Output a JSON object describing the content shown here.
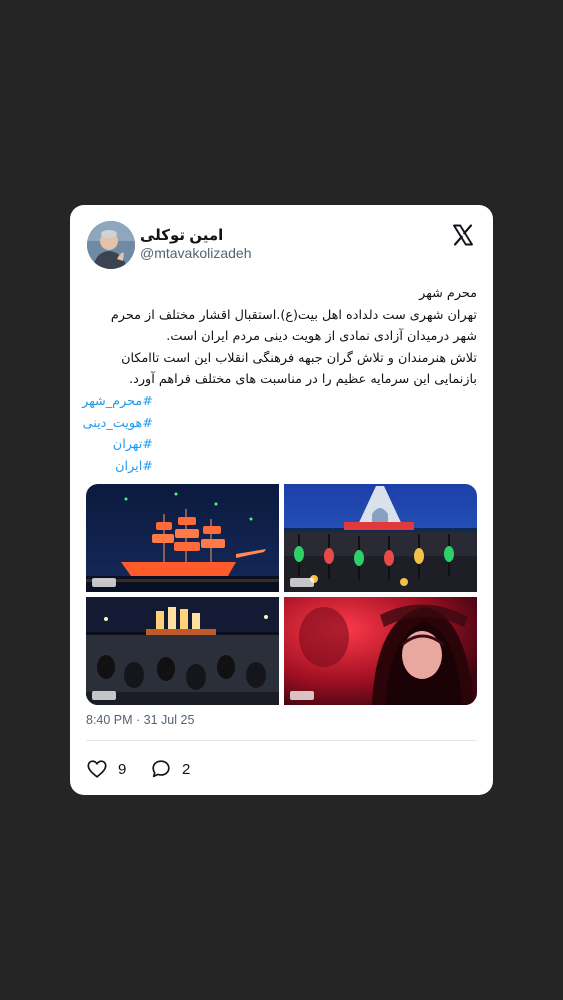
{
  "author": {
    "display_name": "امین توکلی",
    "handle": "@mtavakolizadeh"
  },
  "icons": {
    "brand": "x-logo-icon",
    "like": "heart-icon",
    "reply": "speech-bubble-icon"
  },
  "tweet": {
    "lines": [
      "محرم شهر",
      "تهران شهری ست دلداده اهل بیت(ع).استقبال اقشار مختلف از محرم شهر درمیدان آزادی نمادی از هویت دینی مردم ایران است.",
      "تلاش هنرمندان و تلاش گران جبهه فرهنگی انقلاب این است تاامکان بازنمایی این سرمایه عظیم را در مناسبت های مختلف فراهم آورد."
    ],
    "hashtags": [
      "#محرم_شهر",
      "#هویت_دینی",
      "#تهران",
      "#ایران"
    ],
    "timestamp": "8:40 PM · 31 Jul 25"
  },
  "actions": {
    "likes": "9",
    "replies": "2"
  },
  "colors": {
    "background": "#252525",
    "card": "#ffffff",
    "link": "#1d9bf0",
    "secondary_text": "#536471"
  }
}
